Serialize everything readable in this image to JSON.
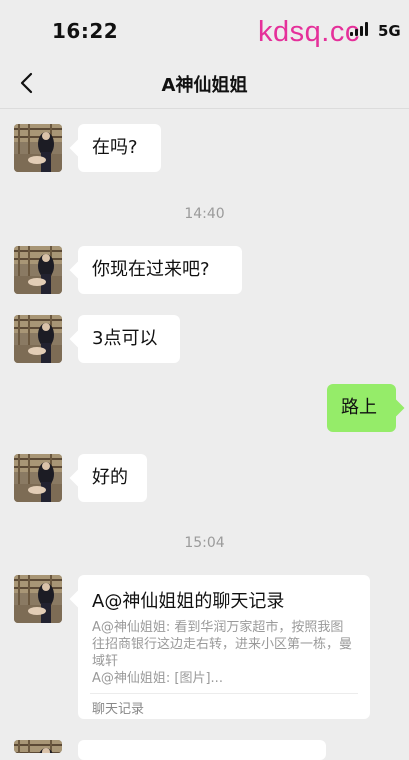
{
  "status_bar": {
    "time": "16:22",
    "network": "5G",
    "watermark": "kdsq.cc"
  },
  "nav": {
    "title": "A神仙姐姐",
    "back_icon": "chevron-left-icon"
  },
  "messages": [
    {
      "side": "left",
      "text": "在吗?"
    },
    {
      "timestamp": "14:40"
    },
    {
      "side": "left",
      "text": "你现在过来吧?"
    },
    {
      "side": "left",
      "text": "3点可以"
    },
    {
      "side": "right",
      "text": "路上"
    },
    {
      "side": "left",
      "text": "好的"
    },
    {
      "timestamp": "15:04"
    }
  ],
  "chat_record": {
    "title": "A@神仙姐姐的聊天记录",
    "lines": [
      "A@神仙姐姐: 看到华润万家超市，按照我图往招商银行这边走右转，进来小区第一栋，曼域轩",
      "A@神仙姐姐: [图片]..."
    ],
    "footer": "聊天记录"
  },
  "colors": {
    "background": "#ededed",
    "bubble_left": "#ffffff",
    "bubble_right": "#95ec69",
    "watermark": "#e5309a"
  }
}
